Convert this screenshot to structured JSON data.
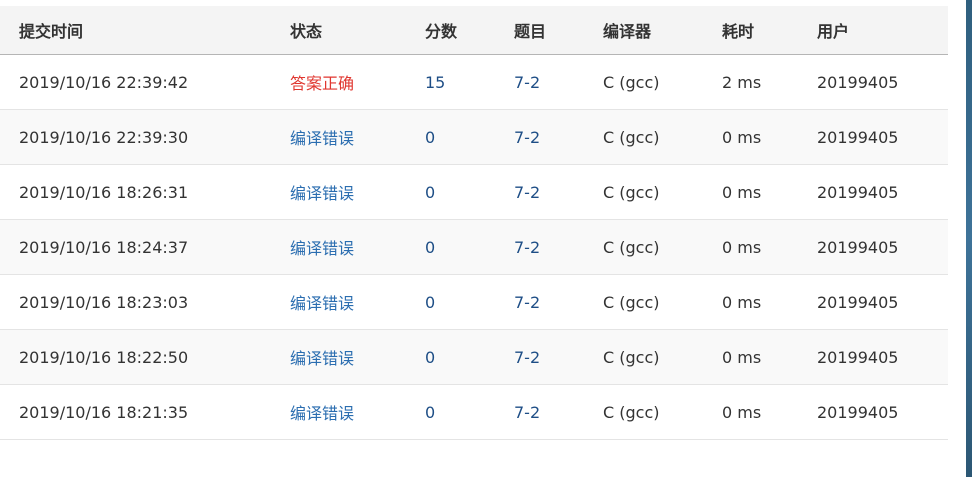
{
  "table": {
    "headers": {
      "submit_time": "提交时间",
      "status": "状态",
      "score": "分数",
      "problem": "题目",
      "compiler": "编译器",
      "time_used": "耗时",
      "user": "用户"
    },
    "rows": [
      {
        "submit_time": "2019/10/16 22:39:42",
        "status": "答案正确",
        "score": "15",
        "problem": "7-2",
        "compiler": "C (gcc)",
        "time_used": "2 ms",
        "user": "20199405"
      },
      {
        "submit_time": "2019/10/16 22:39:30",
        "status": "编译错误",
        "score": "0",
        "problem": "7-2",
        "compiler": "C (gcc)",
        "time_used": "0 ms",
        "user": "20199405"
      },
      {
        "submit_time": "2019/10/16 18:26:31",
        "status": "编译错误",
        "score": "0",
        "problem": "7-2",
        "compiler": "C (gcc)",
        "time_used": "0 ms",
        "user": "20199405"
      },
      {
        "submit_time": "2019/10/16 18:24:37",
        "status": "编译错误",
        "score": "0",
        "problem": "7-2",
        "compiler": "C (gcc)",
        "time_used": "0 ms",
        "user": "20199405"
      },
      {
        "submit_time": "2019/10/16 18:23:03",
        "status": "编译错误",
        "score": "0",
        "problem": "7-2",
        "compiler": "C (gcc)",
        "time_used": "0 ms",
        "user": "20199405"
      },
      {
        "submit_time": "2019/10/16 18:22:50",
        "status": "编译错误",
        "score": "0",
        "problem": "7-2",
        "compiler": "C (gcc)",
        "time_used": "0 ms",
        "user": "20199405"
      },
      {
        "submit_time": "2019/10/16 18:21:35",
        "status": "编译错误",
        "score": "0",
        "problem": "7-2",
        "compiler": "C (gcc)",
        "time_used": "0 ms",
        "user": "20199405"
      }
    ]
  },
  "colors": {
    "accepted": "#e0362f",
    "compile_error": "#2a6db0",
    "link_dark": "#1e4e86",
    "header_bg": "#f4f4f4",
    "alt_row_bg": "#f9f9f9"
  }
}
